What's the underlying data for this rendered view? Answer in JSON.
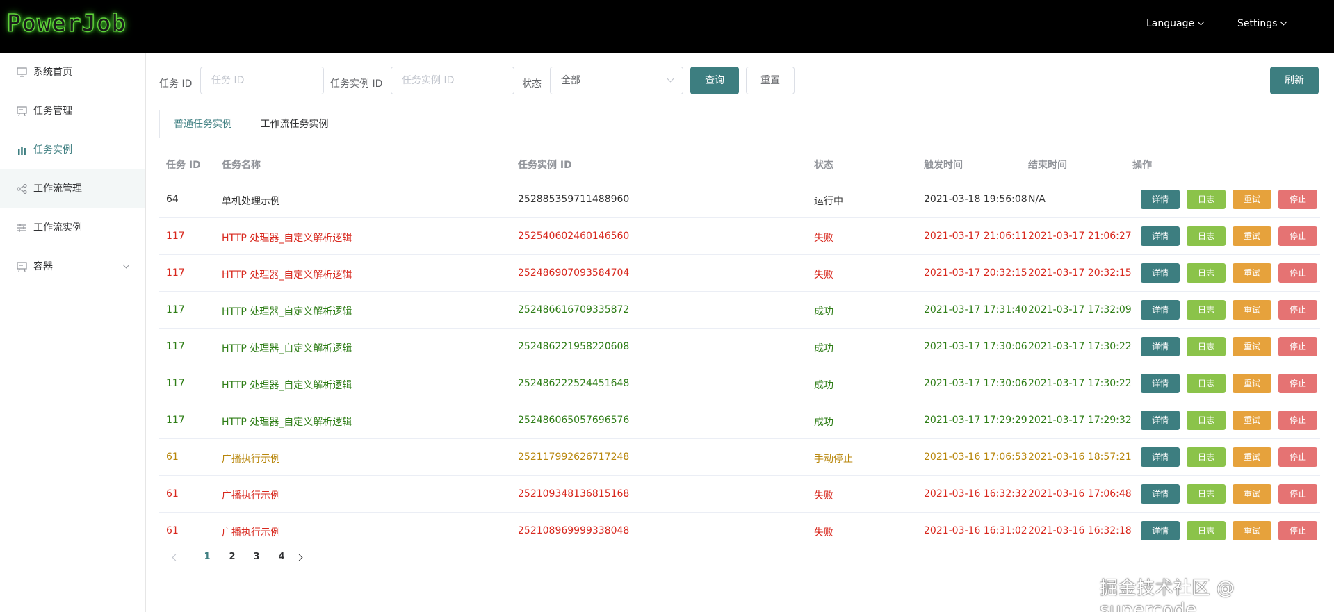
{
  "header": {
    "logo": "PowerJob",
    "language_label": "Language",
    "settings_label": "Settings"
  },
  "sidebar": {
    "items": [
      {
        "label": "系统首页",
        "icon": "monitor-icon"
      },
      {
        "label": "任务管理",
        "icon": "board-icon"
      },
      {
        "label": "任务实例",
        "icon": "bar-chart-icon",
        "active": true
      },
      {
        "label": "工作流管理",
        "icon": "share-icon"
      },
      {
        "label": "工作流实例",
        "icon": "sliders-icon"
      },
      {
        "label": "容器",
        "icon": "board-icon",
        "has_children": true
      }
    ]
  },
  "filters": {
    "task_id_label": "任务 ID",
    "task_id_placeholder": "任务 ID",
    "instance_id_label": "任务实例 ID",
    "instance_id_placeholder": "任务实例 ID",
    "status_label": "状态",
    "status_value": "全部",
    "query_button": "查询",
    "reset_button": "重置",
    "refresh_button": "刷新"
  },
  "tabs": [
    {
      "label": "普通任务实例",
      "active": true
    },
    {
      "label": "工作流任务实例",
      "active": false
    }
  ],
  "table": {
    "columns": [
      "任务 ID",
      "任务名称",
      "任务实例 ID",
      "状态",
      "触发时间",
      "结束时间",
      "操作"
    ],
    "action_labels": {
      "detail": "详情",
      "log": "日志",
      "retry": "重试",
      "stop": "停止"
    },
    "rows": [
      {
        "task_id": "64",
        "name": "单机处理示例",
        "instance_id": "252885359711488960",
        "status": "运行中",
        "trigger_time": "2021-03-18 19:56:08",
        "end_time": "N/A",
        "color": "#333333"
      },
      {
        "task_id": "117",
        "name": "HTTP 处理器_自定义解析逻辑",
        "instance_id": "252540602460146560",
        "status": "失败",
        "trigger_time": "2021-03-17 21:06:11",
        "end_time": "2021-03-17 21:06:27",
        "color": "#d8281e"
      },
      {
        "task_id": "117",
        "name": "HTTP 处理器_自定义解析逻辑",
        "instance_id": "252486907093584704",
        "status": "失败",
        "trigger_time": "2021-03-17 20:32:15",
        "end_time": "2021-03-17 20:32:15",
        "color": "#d8281e"
      },
      {
        "task_id": "117",
        "name": "HTTP 处理器_自定义解析逻辑",
        "instance_id": "252486616709335872",
        "status": "成功",
        "trigger_time": "2021-03-17 17:31:40",
        "end_time": "2021-03-17 17:32:09",
        "color": "#2e7d16"
      },
      {
        "task_id": "117",
        "name": "HTTP 处理器_自定义解析逻辑",
        "instance_id": "252486221958220608",
        "status": "成功",
        "trigger_time": "2021-03-17 17:30:06",
        "end_time": "2021-03-17 17:30:22",
        "color": "#2e7d16"
      },
      {
        "task_id": "117",
        "name": "HTTP 处理器_自定义解析逻辑",
        "instance_id": "252486222524451648",
        "status": "成功",
        "trigger_time": "2021-03-17 17:30:06",
        "end_time": "2021-03-17 17:30:22",
        "color": "#2e7d16"
      },
      {
        "task_id": "117",
        "name": "HTTP 处理器_自定义解析逻辑",
        "instance_id": "252486065057696576",
        "status": "成功",
        "trigger_time": "2021-03-17 17:29:29",
        "end_time": "2021-03-17 17:29:32",
        "color": "#2e7d16"
      },
      {
        "task_id": "61",
        "name": "广播执行示例",
        "instance_id": "252117992626717248",
        "status": "手动停止",
        "trigger_time": "2021-03-16 17:06:53",
        "end_time": "2021-03-16 18:57:21",
        "color": "#b8860b"
      },
      {
        "task_id": "61",
        "name": "广播执行示例",
        "instance_id": "252109348136815168",
        "status": "失败",
        "trigger_time": "2021-03-16 16:32:32",
        "end_time": "2021-03-16 17:06:48",
        "color": "#d8281e"
      },
      {
        "task_id": "61",
        "name": "广播执行示例",
        "instance_id": "252108969999338048",
        "status": "失败",
        "trigger_time": "2021-03-16 16:31:02",
        "end_time": "2021-03-16 16:32:18",
        "color": "#d8281e"
      }
    ]
  },
  "pagination": {
    "pages": [
      "1",
      "2",
      "3",
      "4"
    ],
    "current": "1"
  },
  "watermark": "掘金技术社区 @ supercode",
  "colors": {
    "primary": "#3d7e80",
    "log_button": "#8bc34a",
    "retry_button": "#e6a23c",
    "stop_button": "#e57373"
  }
}
